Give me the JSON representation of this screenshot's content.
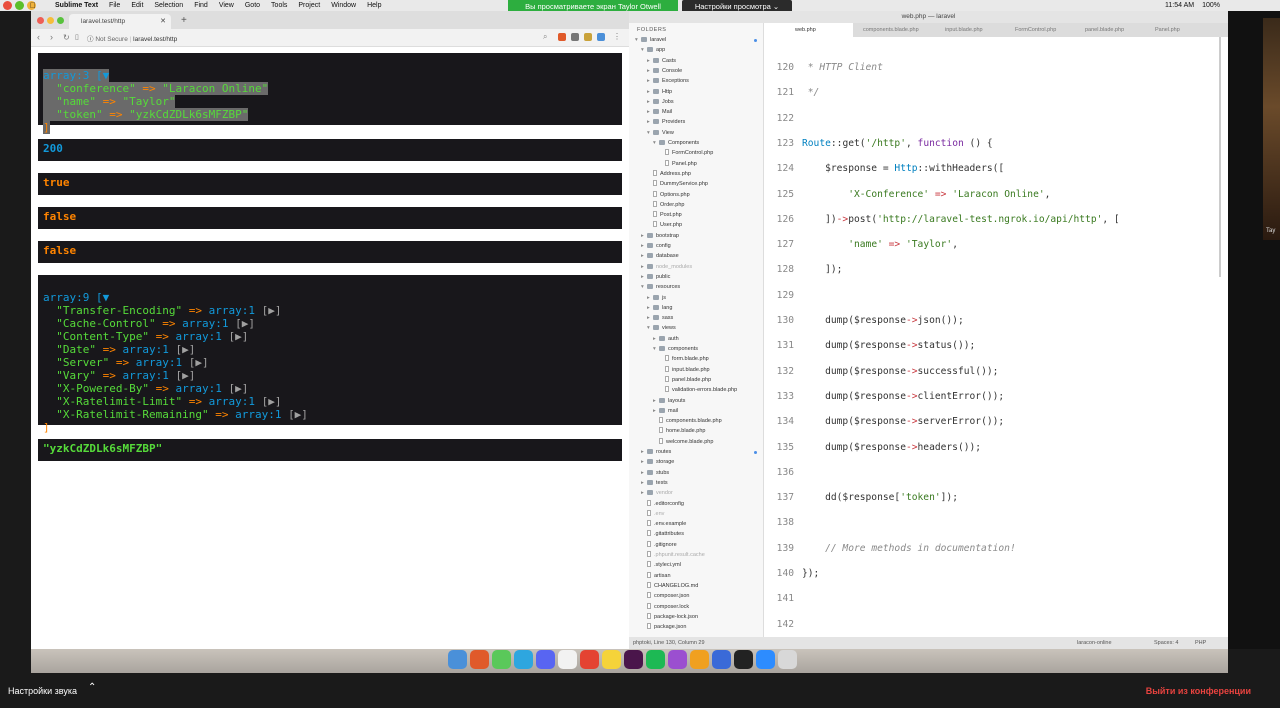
{
  "menubar": {
    "app": "Sublime Text",
    "items": [
      "File",
      "Edit",
      "Selection",
      "Find",
      "View",
      "Goto",
      "Tools",
      "Project",
      "Window",
      "Help"
    ],
    "time": "11:54 AM",
    "battery": "100%"
  },
  "zoom": {
    "sharing_banner": "Вы просматриваете экран Taylor Otwell",
    "view_settings": "Настройки просмотра",
    "audio_settings": "Настройки звука",
    "leave": "Выйти из конференции",
    "thumb_label": "Tay"
  },
  "browser": {
    "tab_title": "laravel.test/http",
    "not_secure": "Not Secure",
    "url": "laravel.test/http"
  },
  "dumps": {
    "json_array_header": "array:3 [▼",
    "json_rows": [
      {
        "key": "\"conference\"",
        "val": "\"Laracon Online\""
      },
      {
        "key": "\"name\"",
        "val": "\"Taylor\""
      },
      {
        "key": "\"token\"",
        "val": "\"yzkCdZDLk6sMFZBP\""
      }
    ],
    "json_close": "]",
    "status": "200",
    "successful": "true",
    "client_error": "false",
    "server_error": "false",
    "headers_header": "array:9 [▼",
    "header_rows": [
      {
        "key": "\"Transfer-Encoding\"",
        "val": "array:1"
      },
      {
        "key": "\"Cache-Control\"",
        "val": "array:1"
      },
      {
        "key": "\"Content-Type\"",
        "val": "array:1"
      },
      {
        "key": "\"Date\"",
        "val": "array:1"
      },
      {
        "key": "\"Server\"",
        "val": "array:1"
      },
      {
        "key": "\"Vary\"",
        "val": "array:1"
      },
      {
        "key": "\"X-Powered-By\"",
        "val": "array:1"
      },
      {
        "key": "\"X-Ratelimit-Limit\"",
        "val": "array:1"
      },
      {
        "key": "\"X-Ratelimit-Remaining\"",
        "val": "array:1"
      }
    ],
    "headers_close": "]",
    "token": "\"yzkCdZDLk6sMFZBP\"",
    "arrow": "=>",
    "toggle": "[▶]"
  },
  "sublime": {
    "title": "web.php — laravel",
    "tabs": [
      "web.php",
      "components.blade.php",
      "input.blade.php",
      "FormControl.php",
      "panel.blade.php",
      "Panel.php"
    ],
    "folders_label": "FOLDERS",
    "status_left": "phptoki, Line 130, Column 29",
    "status_branch": "laracon-online",
    "status_spaces": "Spaces: 4",
    "status_syntax": "PHP"
  },
  "tree": [
    {
      "label": "laravel",
      "depth": 0,
      "type": "folder",
      "open": true
    },
    {
      "label": "app",
      "depth": 1,
      "type": "folder",
      "open": true
    },
    {
      "label": "Casts",
      "depth": 2,
      "type": "folder"
    },
    {
      "label": "Console",
      "depth": 2,
      "type": "folder"
    },
    {
      "label": "Exceptions",
      "depth": 2,
      "type": "folder"
    },
    {
      "label": "Http",
      "depth": 2,
      "type": "folder"
    },
    {
      "label": "Jobs",
      "depth": 2,
      "type": "folder"
    },
    {
      "label": "Mail",
      "depth": 2,
      "type": "folder"
    },
    {
      "label": "Providers",
      "depth": 2,
      "type": "folder"
    },
    {
      "label": "View",
      "depth": 2,
      "type": "folder",
      "open": true
    },
    {
      "label": "Components",
      "depth": 3,
      "type": "folder",
      "open": true
    },
    {
      "label": "FormControl.php",
      "depth": 4,
      "type": "file"
    },
    {
      "label": "Panel.php",
      "depth": 4,
      "type": "file"
    },
    {
      "label": "Address.php",
      "depth": 2,
      "type": "file"
    },
    {
      "label": "DummyService.php",
      "depth": 2,
      "type": "file"
    },
    {
      "label": "Options.php",
      "depth": 2,
      "type": "file"
    },
    {
      "label": "Order.php",
      "depth": 2,
      "type": "file"
    },
    {
      "label": "Post.php",
      "depth": 2,
      "type": "file"
    },
    {
      "label": "User.php",
      "depth": 2,
      "type": "file"
    },
    {
      "label": "bootstrap",
      "depth": 1,
      "type": "folder"
    },
    {
      "label": "config",
      "depth": 1,
      "type": "folder"
    },
    {
      "label": "database",
      "depth": 1,
      "type": "folder"
    },
    {
      "label": "node_modules",
      "depth": 1,
      "type": "folder",
      "dim": true
    },
    {
      "label": "public",
      "depth": 1,
      "type": "folder"
    },
    {
      "label": "resources",
      "depth": 1,
      "type": "folder",
      "open": true
    },
    {
      "label": "js",
      "depth": 2,
      "type": "folder"
    },
    {
      "label": "lang",
      "depth": 2,
      "type": "folder"
    },
    {
      "label": "sass",
      "depth": 2,
      "type": "folder"
    },
    {
      "label": "views",
      "depth": 2,
      "type": "folder",
      "open": true
    },
    {
      "label": "auth",
      "depth": 3,
      "type": "folder"
    },
    {
      "label": "components",
      "depth": 3,
      "type": "folder",
      "open": true
    },
    {
      "label": "form.blade.php",
      "depth": 4,
      "type": "file"
    },
    {
      "label": "input.blade.php",
      "depth": 4,
      "type": "file"
    },
    {
      "label": "panel.blade.php",
      "depth": 4,
      "type": "file"
    },
    {
      "label": "validation-errors.blade.php",
      "depth": 4,
      "type": "file"
    },
    {
      "label": "layouts",
      "depth": 3,
      "type": "folder"
    },
    {
      "label": "mail",
      "depth": 3,
      "type": "folder"
    },
    {
      "label": "components.blade.php",
      "depth": 3,
      "type": "file"
    },
    {
      "label": "home.blade.php",
      "depth": 3,
      "type": "file"
    },
    {
      "label": "welcome.blade.php",
      "depth": 3,
      "type": "file"
    },
    {
      "label": "routes",
      "depth": 1,
      "type": "folder"
    },
    {
      "label": "storage",
      "depth": 1,
      "type": "folder"
    },
    {
      "label": "stubs",
      "depth": 1,
      "type": "folder"
    },
    {
      "label": "tests",
      "depth": 1,
      "type": "folder"
    },
    {
      "label": "vendor",
      "depth": 1,
      "type": "folder",
      "dim": true
    },
    {
      "label": ".editorconfig",
      "depth": 1,
      "type": "file"
    },
    {
      "label": ".env",
      "depth": 1,
      "type": "file",
      "dim": true
    },
    {
      "label": ".env.example",
      "depth": 1,
      "type": "file"
    },
    {
      "label": ".gitattributes",
      "depth": 1,
      "type": "file"
    },
    {
      "label": ".gitignore",
      "depth": 1,
      "type": "file"
    },
    {
      "label": ".phpunit.result.cache",
      "depth": 1,
      "type": "file",
      "dim": true
    },
    {
      "label": ".styleci.yml",
      "depth": 1,
      "type": "file"
    },
    {
      "label": "artisan",
      "depth": 1,
      "type": "file"
    },
    {
      "label": "CHANGELOG.md",
      "depth": 1,
      "type": "file"
    },
    {
      "label": "composer.json",
      "depth": 1,
      "type": "file"
    },
    {
      "label": "composer.lock",
      "depth": 1,
      "type": "file"
    },
    {
      "label": "package-lock.json",
      "depth": 1,
      "type": "file"
    },
    {
      "label": "package.json",
      "depth": 1,
      "type": "file"
    }
  ],
  "code": [
    {
      "n": "120",
      "html": "<span class='c-cmt'> * HTTP Client</span>"
    },
    {
      "n": "121",
      "html": "<span class='c-cmt'> */</span>"
    },
    {
      "n": "122",
      "html": ""
    },
    {
      "n": "123",
      "html": "<span class='c-cls'>Route</span>::get(<span class='c-str'>'/http'</span>, <span class='c-kw'>function</span> () {"
    },
    {
      "n": "124",
      "html": "    $response = <span class='c-cls'>Http</span>::withHeaders(["
    },
    {
      "n": "125",
      "html": "        <span class='c-str'>'X-Conference'</span> <span class='c-op'>=></span> <span class='c-str'>'Laracon Online'</span>,"
    },
    {
      "n": "126",
      "html": "    ])<span class='c-op'>-></span>post(<span class='c-str'>'http://laravel-test.ngrok.io/api/http'</span>, ["
    },
    {
      "n": "127",
      "html": "        <span class='c-str'>'name'</span> <span class='c-op'>=></span> <span class='c-str'>'Taylor'</span>,"
    },
    {
      "n": "128",
      "html": "    ]);"
    },
    {
      "n": "129",
      "html": ""
    },
    {
      "n": "130",
      "html": "    dump($response<span class='c-op'>-></span>json());"
    },
    {
      "n": "131",
      "html": "    dump($response<span class='c-op'>-></span>status());"
    },
    {
      "n": "132",
      "html": "    dump($response<span class='c-op'>-></span>successful());"
    },
    {
      "n": "133",
      "html": "    dump($response<span class='c-op'>-></span>clientError());"
    },
    {
      "n": "134",
      "html": "    dump($response<span class='c-op'>-></span>serverError());"
    },
    {
      "n": "135",
      "html": "    dump($response<span class='c-op'>-></span>headers());"
    },
    {
      "n": "136",
      "html": ""
    },
    {
      "n": "137",
      "html": "    dd($response[<span class='c-str'>'token'</span>]);"
    },
    {
      "n": "138",
      "html": ""
    },
    {
      "n": "139",
      "html": "    <span class='c-cmt'>// More methods in documentation!</span>"
    },
    {
      "n": "140",
      "html": "});"
    },
    {
      "n": "141",
      "html": ""
    },
    {
      "n": "142",
      "html": ""
    }
  ],
  "colors": {
    "dump_bg": "#18171b",
    "dump_key": "#56db3a",
    "dump_arrow": "#ff8400",
    "dump_array": "#1299da",
    "zoom_green": "#2dae3f",
    "zoom_leave": "#e8433f"
  },
  "dock_icons": [
    "finder-icon",
    "brave-icon",
    "messages-icon",
    "telegram-icon",
    "discord-icon",
    "calendar-icon",
    "todoist-icon",
    "notes-icon",
    "slack-icon",
    "spotify-icon",
    "podcasts-icon",
    "sublime-icon",
    "tinkerwell-icon",
    "terminal-icon",
    "zoom-icon",
    "trash-icon"
  ]
}
